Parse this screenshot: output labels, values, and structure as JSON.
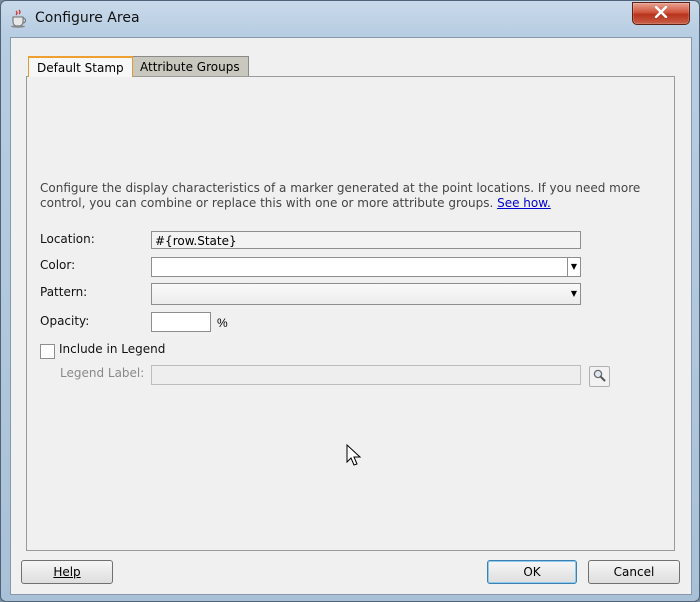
{
  "window": {
    "title": "Configure Area"
  },
  "tabs": [
    {
      "label": "Default Stamp",
      "active": true
    },
    {
      "label": "Attribute Groups",
      "active": false
    }
  ],
  "description": {
    "text": "Configure the display characteristics of a marker generated at the point locations. If you need more control, you can combine or replace this with one or more attribute groups.",
    "link": "See how."
  },
  "form": {
    "location_label": "Location:",
    "location_value": "#{row.State}",
    "color_label": "Color:",
    "color_value": "",
    "pattern_label": "Pattern:",
    "pattern_value": "",
    "opacity_label": "Opacity:",
    "opacity_value": "",
    "opacity_unit": "%",
    "include_legend_label": "Include in Legend",
    "include_legend_checked": false,
    "legend_label_label": "Legend Label:",
    "legend_label_value": ""
  },
  "buttons": {
    "help": "Help",
    "ok": "OK",
    "cancel": "Cancel"
  },
  "icons": {
    "close": "close-icon",
    "app": "coffee-cup-icon",
    "search": "search-icon"
  }
}
